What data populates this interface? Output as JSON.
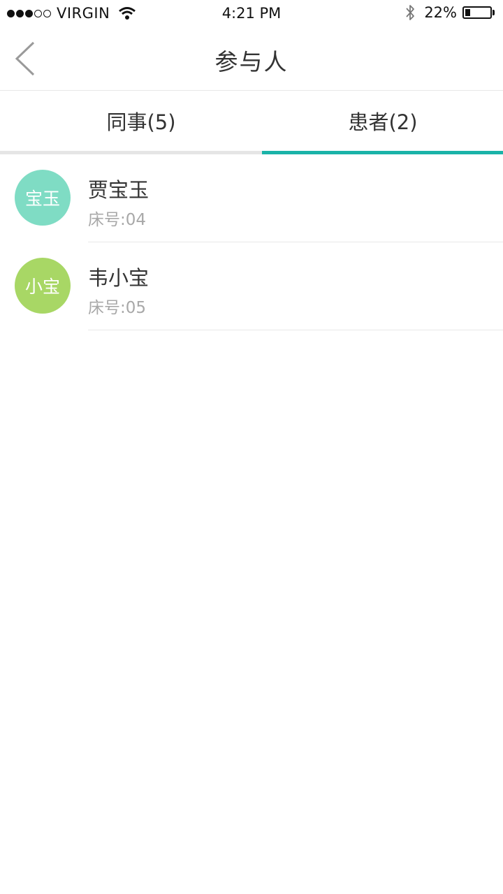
{
  "status_bar": {
    "carrier": "VIRGIN",
    "signal_dots": [
      true,
      true,
      true,
      false,
      false
    ],
    "time": "4:21 PM",
    "battery_text": "22%",
    "battery_level": 0.22,
    "icons": [
      "signal-dots-icon",
      "wifi-icon",
      "bluetooth-icon",
      "battery-icon"
    ]
  },
  "header": {
    "title": "参与人",
    "back_icon": "chevron-left-icon"
  },
  "tabs": [
    {
      "label": "同事(5)",
      "active": false
    },
    {
      "label": "患者(2)",
      "active": true
    }
  ],
  "patients": [
    {
      "avatar_text": "宝玉",
      "avatar_color": "#7fdcc4",
      "name": "贾宝玉",
      "bed": "床号:04"
    },
    {
      "avatar_text": "小宝",
      "avatar_color": "#a8d765",
      "name": "韦小宝",
      "bed": "床号:05"
    }
  ],
  "colors": {
    "accent": "#1ab3a8",
    "divider": "#e8e8e8",
    "secondary_text": "#a8a8a8"
  }
}
